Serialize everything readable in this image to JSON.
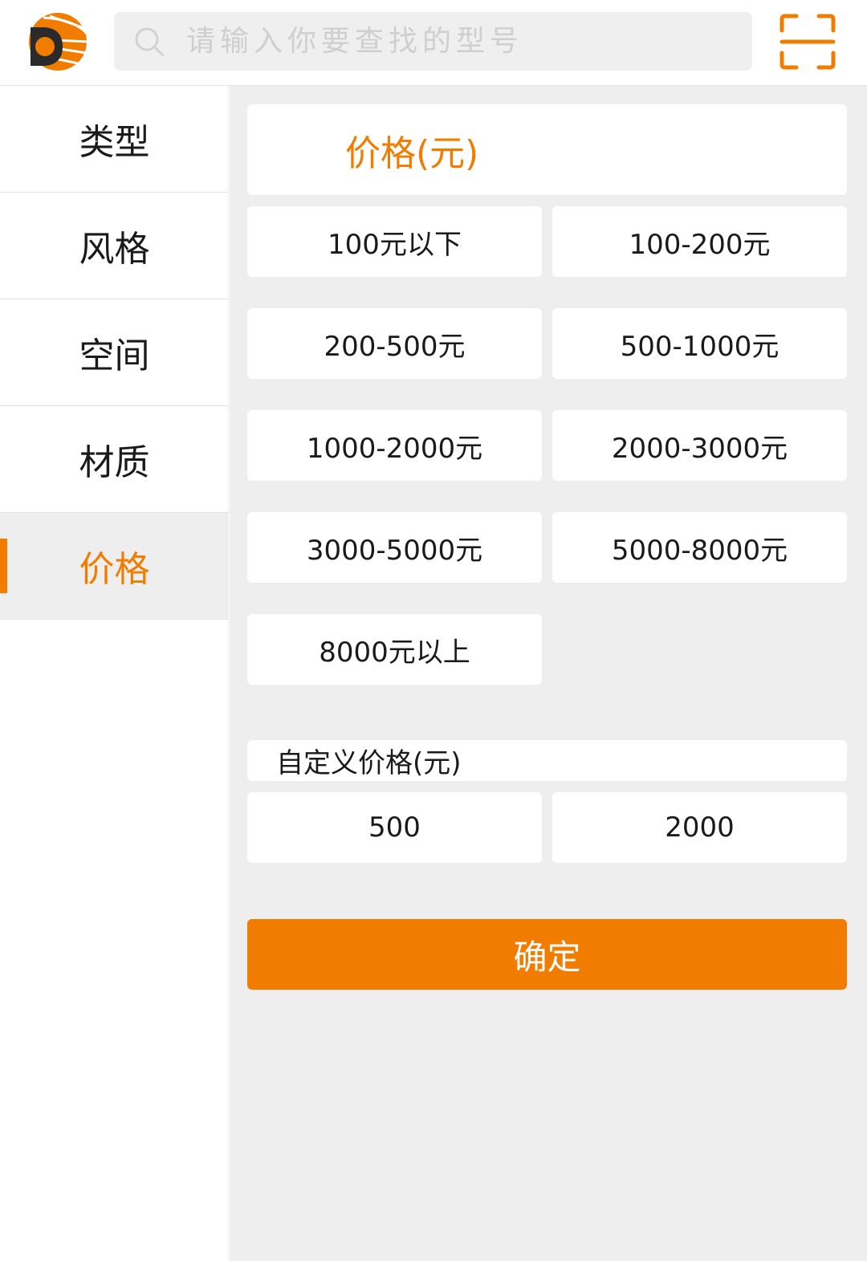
{
  "header": {
    "logo_icon": "brand-logo-icon",
    "search_placeholder": "请输入你要查找的型号",
    "search_icon": "search-icon",
    "scan_icon": "scan-icon"
  },
  "sidebar": {
    "items": [
      {
        "label": "类型",
        "active": false
      },
      {
        "label": "风格",
        "active": false
      },
      {
        "label": "空间",
        "active": false
      },
      {
        "label": "材质",
        "active": false
      },
      {
        "label": "价格",
        "active": true
      }
    ]
  },
  "filter": {
    "title": "价格(元)",
    "options": [
      "100元以下",
      "100-200元",
      "200-500元",
      "500-1000元",
      "1000-2000元",
      "2000-3000元",
      "3000-5000元",
      "5000-8000元",
      "8000元以上"
    ],
    "custom_label": "自定义价格(元)",
    "min_value": "500",
    "max_value": "2000",
    "confirm_label": "确定"
  },
  "colors": {
    "accent": "#f07c00",
    "page_bg": "#eeeeee",
    "search_bg": "#efefef"
  }
}
